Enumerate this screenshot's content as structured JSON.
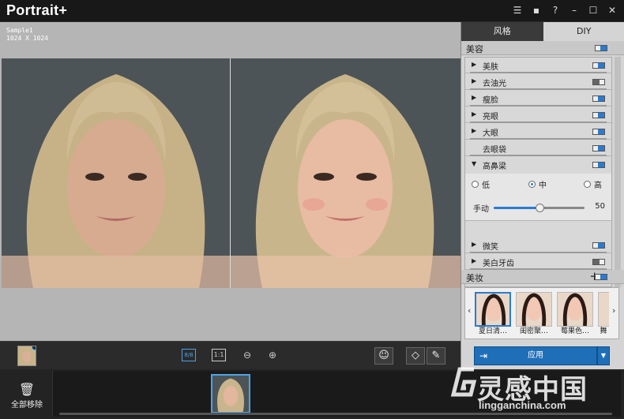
{
  "app": {
    "title": "Portrait+"
  },
  "titlebar": {
    "icons": [
      "list-icon",
      "chat-icon",
      "help-icon",
      "minimize-icon",
      "maximize-icon",
      "close-icon"
    ],
    "help_label": "?"
  },
  "canvas": {
    "sample_name": "Sample1",
    "sample_size": "1024 X 1024"
  },
  "bottombar": {
    "view_split_label": "8/8",
    "view_1to1_label": "1:1"
  },
  "filmstrip": {
    "remove_all_label": "全部移除"
  },
  "panel": {
    "tabs": [
      {
        "label": "风格"
      },
      {
        "label": "DIY"
      }
    ],
    "beauty_section": "美容",
    "items": [
      {
        "label": "美肤",
        "arrow": "▶",
        "on": true
      },
      {
        "label": "去油光",
        "arrow": "▶",
        "on": false
      },
      {
        "label": "瘦脸",
        "arrow": "▶",
        "on": true
      },
      {
        "label": "亮眼",
        "arrow": "▶",
        "on": true
      },
      {
        "label": "大眼",
        "arrow": "▶",
        "on": true
      },
      {
        "label": "去眼袋",
        "arrow": "",
        "on": true
      },
      {
        "label": "高鼻梁",
        "arrow": "▼",
        "on": true
      },
      {
        "label": "微笑",
        "arrow": "▶",
        "on": true
      },
      {
        "label": "美白牙齿",
        "arrow": "▶",
        "on": false
      }
    ],
    "nose": {
      "options": [
        "低",
        "中",
        "高"
      ],
      "selected": "中",
      "manual_label": "手动",
      "value": 50,
      "value_text": "50"
    },
    "makeup_section": "美妆",
    "makeup_plus": "+",
    "makeup_items": [
      {
        "label": "夏日清…"
      },
      {
        "label": "闺密聚…"
      },
      {
        "label": "莓果色…"
      },
      {
        "label": "舞"
      }
    ],
    "apply_label": "应用"
  },
  "watermark": {
    "big": "灵感中国",
    "small": "lingganchina.com"
  },
  "colors": {
    "accent": "#1f6fb8",
    "toggle_on": "#2a7bd0",
    "titlebar": "#181818"
  }
}
